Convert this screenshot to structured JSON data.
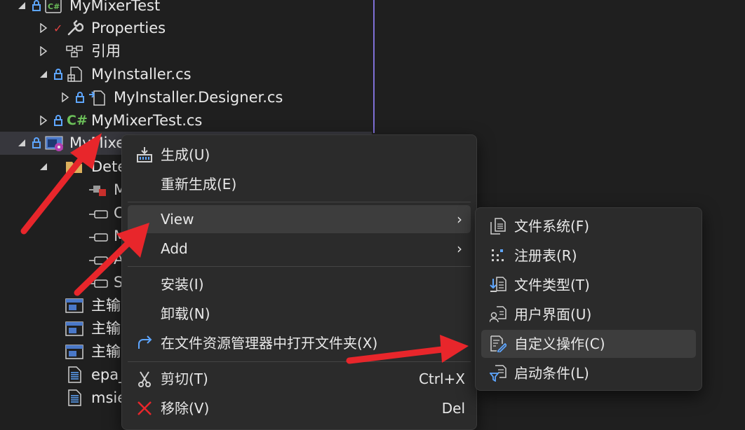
{
  "tree": {
    "rows": [
      {
        "label": "MyMixerTest"
      },
      {
        "label": "Properties"
      },
      {
        "label": "引用"
      },
      {
        "label": "MyInstaller.cs"
      },
      {
        "label": "MyInstaller.Designer.cs"
      },
      {
        "label": "MyMixerTest.cs"
      },
      {
        "label": "MyMixe"
      },
      {
        "label": "Dete"
      },
      {
        "label": "M"
      },
      {
        "label": "C"
      },
      {
        "label": "M"
      },
      {
        "label": "A"
      },
      {
        "label": "S"
      },
      {
        "label": "主输"
      },
      {
        "label": "主输"
      },
      {
        "label": "主输"
      },
      {
        "label": "epa_"
      },
      {
        "label": "msie"
      }
    ]
  },
  "context_menu": {
    "items": [
      {
        "label": "生成(U)"
      },
      {
        "label": "重新生成(E)"
      },
      {
        "label": "View"
      },
      {
        "label": "Add"
      },
      {
        "label": "安装(I)"
      },
      {
        "label": "卸载(N)"
      },
      {
        "label": "在文件资源管理器中打开文件夹(X)"
      },
      {
        "label": "剪切(T)",
        "shortcut": "Ctrl+X"
      },
      {
        "label": "移除(V)",
        "shortcut": "Del"
      }
    ]
  },
  "submenu": {
    "items": [
      {
        "label": "文件系统(F)"
      },
      {
        "label": "注册表(R)"
      },
      {
        "label": "文件类型(T)"
      },
      {
        "label": "用户界面(U)"
      },
      {
        "label": "自定义操作(C)"
      },
      {
        "label": "启动条件(L)"
      }
    ]
  },
  "colors": {
    "background": "#1f1f1f",
    "menu_background": "#2b2b2b",
    "highlight": "#3d3d3d",
    "csharp_green": "#6bbf59",
    "lock_blue": "#5ea6ff",
    "annotation_red": "#e8262b"
  }
}
